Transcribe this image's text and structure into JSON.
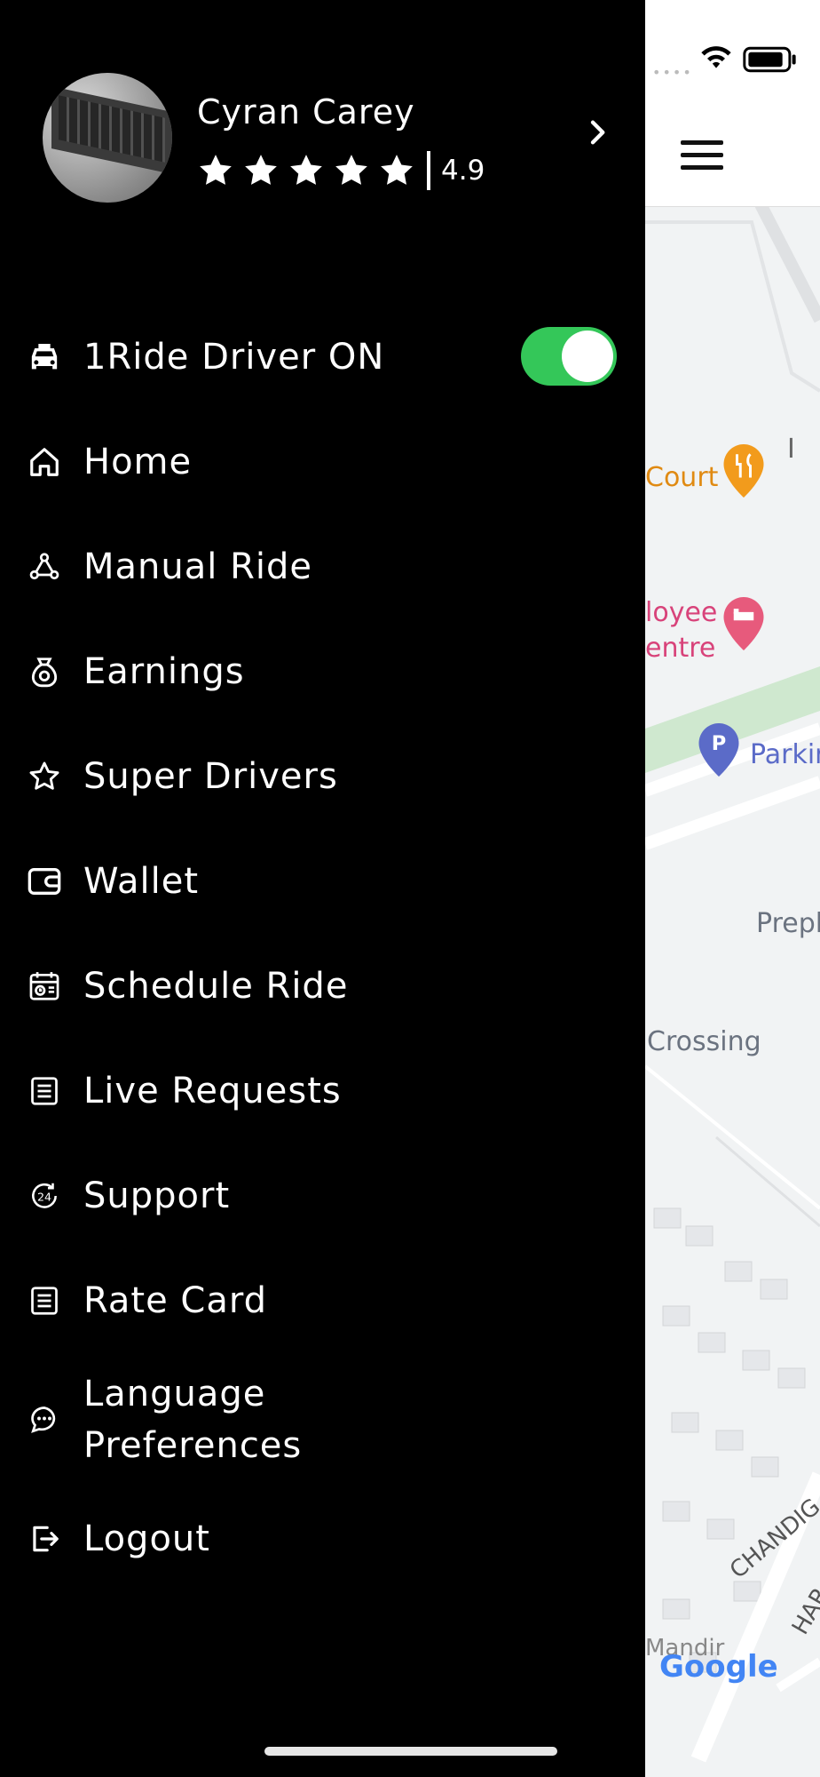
{
  "profile": {
    "name": "Cyran Carey",
    "rating": "4.9",
    "stars": 5
  },
  "menu": {
    "driver_toggle_label": "1Ride Driver ON",
    "driver_toggle_on": true,
    "items": [
      {
        "label": "Home",
        "icon": "home-icon"
      },
      {
        "label": "Manual Ride",
        "icon": "network-icon"
      },
      {
        "label": "Earnings",
        "icon": "money-bag-icon"
      },
      {
        "label": "Super Drivers",
        "icon": "star-icon"
      },
      {
        "label": "Wallet",
        "icon": "wallet-icon"
      },
      {
        "label": "Schedule Ride",
        "icon": "calendar-icon"
      },
      {
        "label": "Live Requests",
        "icon": "list-icon"
      },
      {
        "label": "Support",
        "icon": "support-24-icon"
      },
      {
        "label": "Rate Card",
        "icon": "list-icon"
      },
      {
        "label": "Language\nPreferences",
        "icon": "chat-bubble-icon"
      },
      {
        "label": "Logout",
        "icon": "logout-icon"
      }
    ]
  },
  "map": {
    "labels": {
      "court": "Court",
      "employee_1": "loyee",
      "employee_2": "entre",
      "parking": "Parkir",
      "prepl": "Prepl",
      "crossing": "Crossing",
      "chandig": "CHANDIG",
      "har": "HAR",
      "mandir": "Mandir",
      "partial_i": "I",
      "google": "Google"
    },
    "colors": {
      "restaurant": "#f29b1c",
      "lodging": "#e75a7c",
      "parking": "#5b6bc8",
      "green": "#cfe8cf"
    }
  },
  "status": {
    "wifi_icon": "wifi-icon",
    "battery_icon": "battery-icon"
  }
}
